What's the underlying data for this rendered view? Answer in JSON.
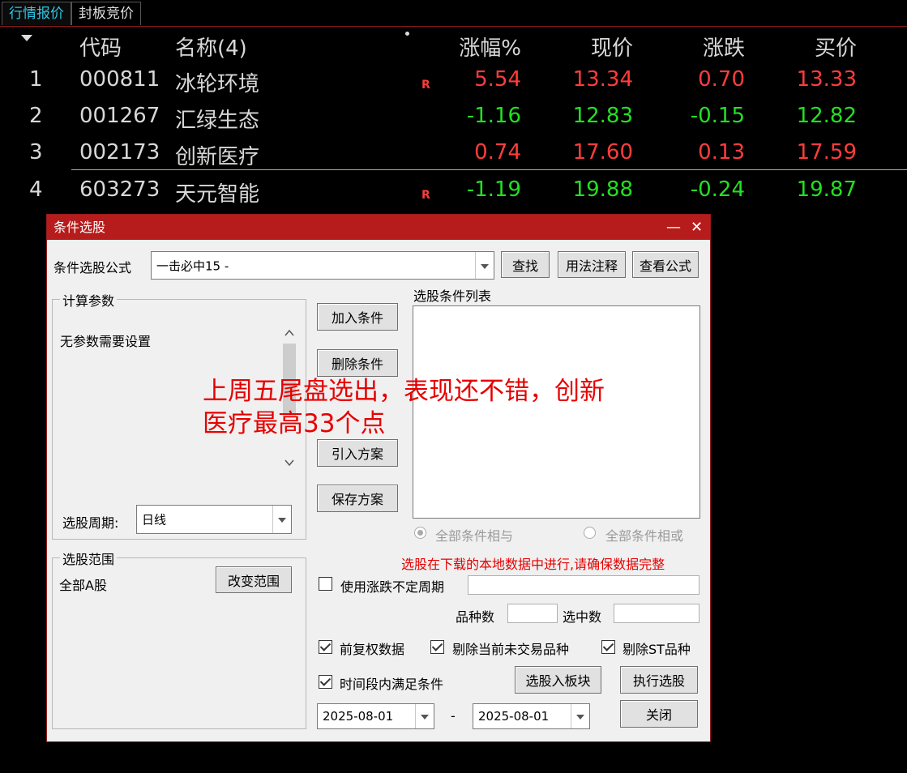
{
  "tabs": [
    {
      "label": "行情报价"
    },
    {
      "label": "封板竞价"
    }
  ],
  "quote_table": {
    "headers": {
      "code": "代码",
      "name": "名称(4)",
      "pct": "涨幅%",
      "price": "现价",
      "chg": "涨跌",
      "bid": "买价"
    },
    "rows": [
      {
        "idx": "1",
        "code": "000811",
        "name": "冰轮环境",
        "flag": "R",
        "pct": "5.54",
        "price": "13.34",
        "chg": "0.70",
        "bid": "13.33",
        "trend": "up"
      },
      {
        "idx": "2",
        "code": "001267",
        "name": "汇绿生态",
        "flag": "",
        "pct": "-1.16",
        "price": "12.83",
        "chg": "-0.15",
        "bid": "12.82",
        "trend": "down"
      },
      {
        "idx": "3",
        "code": "002173",
        "name": "创新医疗",
        "flag": "",
        "pct": "0.74",
        "price": "17.60",
        "chg": "0.13",
        "bid": "17.59",
        "trend": "up"
      },
      {
        "idx": "4",
        "code": "603273",
        "name": "天元智能",
        "flag": "R",
        "pct": "-1.19",
        "price": "19.88",
        "chg": "-0.24",
        "bid": "19.87",
        "trend": "down"
      }
    ],
    "colors": {
      "up": "#ff3c3c",
      "down": "#22e022"
    }
  },
  "dialog": {
    "title": "条件选股",
    "minimize": "—",
    "close": "✕",
    "formula_label": "条件选股公式",
    "formula_value": "一击必中15  -",
    "find_btn": "查找",
    "usage_btn": "用法注释",
    "view_btn": "查看公式",
    "params_group": "计算参数",
    "params_text": "无参数需要设置",
    "period_label": "选股周期:",
    "period_value": "日线",
    "add_cond_btn": "加入条件",
    "del_cond_btn": "删除条件",
    "import_btn": "引入方案",
    "save_btn": "保存方案",
    "cond_list_label": "选股条件列表",
    "radio_and": "全部条件相与",
    "radio_or": "全部条件相或",
    "warning": "选股在下载的本地数据中进行,请确保数据完整",
    "range_group": "选股范围",
    "range_value": "全部A股",
    "change_range_btn": "改变范围",
    "use_indef_period": "使用涨跌不定周期",
    "count_label": "品种数",
    "selected_label": "选中数",
    "chk_fq": "前复权数据",
    "chk_untraded": "剔除当前未交易品种",
    "chk_st": "剔除ST品种",
    "chk_period": "时间段内满足条件",
    "to_block_btn": "选股入板块",
    "execute_btn": "执行选股",
    "date_from": "2025-08-01",
    "date_sep": "-",
    "date_to": "2025-08-01",
    "close_btn": "关闭"
  },
  "annotation": {
    "line1": "上周五尾盘选出，表现还不错，创新",
    "line2": "医疗最高33个点"
  }
}
